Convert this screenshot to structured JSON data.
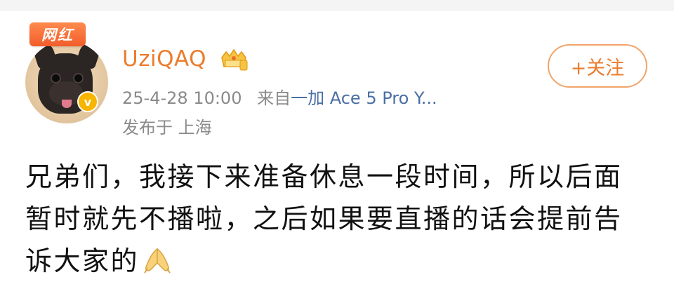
{
  "header": {
    "badge_label": "网红",
    "username": "UziQAQ",
    "timestamp": "25-4-28 10:00",
    "source_prefix": "来自",
    "source_device": "一加 Ace 5 Pro Y...",
    "location": "发布于 上海",
    "follow_label": "+关注"
  },
  "post": {
    "text": "兄弟们，我接下来准备休息一段时间，所以后面暂时就先不播啦，之后如果要直播的话会提前告诉大家的"
  },
  "icons": {
    "verified": "verified-icon",
    "vip": "vip-crown-icon",
    "emoji": "praying-hands-icon"
  },
  "colors": {
    "accent": "#eb7c2e",
    "link": "#4a6fa5",
    "meta": "#8a8a8a",
    "badge": "#f25c2a",
    "verified": "#f7b500"
  }
}
